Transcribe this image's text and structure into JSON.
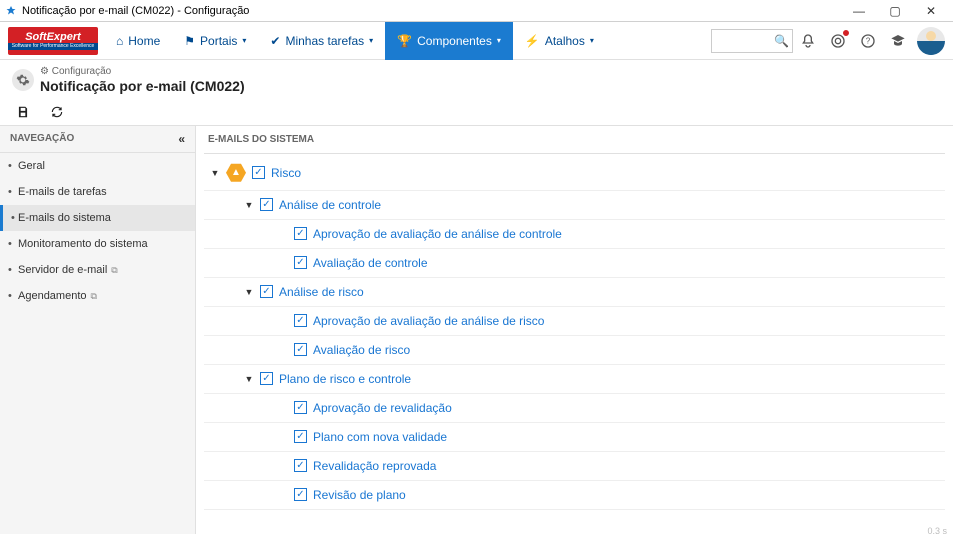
{
  "window": {
    "title": "Notificação por e-mail (CM022) - Configuração"
  },
  "brand": {
    "main": "SoftExpert",
    "sub": "Software for Performance Excellence"
  },
  "topnav": {
    "home": "Home",
    "portais": "Portais",
    "tarefas": "Minhas tarefas",
    "componentes": "Componentes",
    "atalhos": "Atalhos",
    "search_placeholder": ""
  },
  "page": {
    "breadcrumb": "Configuração",
    "title": "Notificação por e-mail (CM022)"
  },
  "sidebar": {
    "heading": "NAVEGAÇÃO",
    "items": [
      {
        "label": "Geral",
        "external": false,
        "active": false
      },
      {
        "label": "E-mails de tarefas",
        "external": false,
        "active": false
      },
      {
        "label": "E-mails do sistema",
        "external": false,
        "active": true
      },
      {
        "label": "Monitoramento do sistema",
        "external": false,
        "active": false
      },
      {
        "label": "Servidor de e-mail",
        "external": true,
        "active": false
      },
      {
        "label": "Agendamento",
        "external": true,
        "active": false
      }
    ]
  },
  "main": {
    "heading": "E-MAILS DO SISTEMA",
    "tree": {
      "root": {
        "label": "Risco",
        "checked": true
      },
      "groups": [
        {
          "label": "Análise de controle",
          "checked": true,
          "items": [
            {
              "label": "Aprovação de avaliação de análise de controle",
              "checked": true
            },
            {
              "label": "Avaliação de controle",
              "checked": true
            }
          ]
        },
        {
          "label": "Análise de risco",
          "checked": true,
          "items": [
            {
              "label": "Aprovação de avaliação de análise de risco",
              "checked": true
            },
            {
              "label": "Avaliação de risco",
              "checked": true
            }
          ]
        },
        {
          "label": "Plano de risco e controle",
          "checked": true,
          "items": [
            {
              "label": "Aprovação de revalidação",
              "checked": true
            },
            {
              "label": "Plano com nova validade",
              "checked": true
            },
            {
              "label": "Revalidação reprovada",
              "checked": true
            },
            {
              "label": "Revisão de plano",
              "checked": true
            }
          ]
        }
      ]
    }
  },
  "footer": {
    "version": "0.3 s"
  }
}
